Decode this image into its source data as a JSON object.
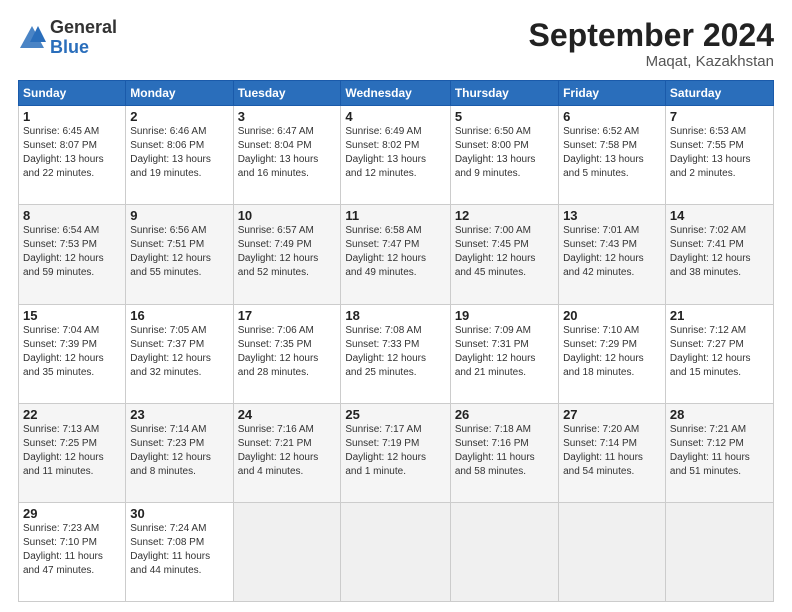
{
  "logo": {
    "general": "General",
    "blue": "Blue"
  },
  "title": "September 2024",
  "subtitle": "Maqat, Kazakhstan",
  "days_header": [
    "Sunday",
    "Monday",
    "Tuesday",
    "Wednesday",
    "Thursday",
    "Friday",
    "Saturday"
  ],
  "weeks": [
    [
      {
        "day": "1",
        "info": "Sunrise: 6:45 AM\nSunset: 8:07 PM\nDaylight: 13 hours\nand 22 minutes."
      },
      {
        "day": "2",
        "info": "Sunrise: 6:46 AM\nSunset: 8:06 PM\nDaylight: 13 hours\nand 19 minutes."
      },
      {
        "day": "3",
        "info": "Sunrise: 6:47 AM\nSunset: 8:04 PM\nDaylight: 13 hours\nand 16 minutes."
      },
      {
        "day": "4",
        "info": "Sunrise: 6:49 AM\nSunset: 8:02 PM\nDaylight: 13 hours\nand 12 minutes."
      },
      {
        "day": "5",
        "info": "Sunrise: 6:50 AM\nSunset: 8:00 PM\nDaylight: 13 hours\nand 9 minutes."
      },
      {
        "day": "6",
        "info": "Sunrise: 6:52 AM\nSunset: 7:58 PM\nDaylight: 13 hours\nand 5 minutes."
      },
      {
        "day": "7",
        "info": "Sunrise: 6:53 AM\nSunset: 7:55 PM\nDaylight: 13 hours\nand 2 minutes."
      }
    ],
    [
      {
        "day": "8",
        "info": "Sunrise: 6:54 AM\nSunset: 7:53 PM\nDaylight: 12 hours\nand 59 minutes."
      },
      {
        "day": "9",
        "info": "Sunrise: 6:56 AM\nSunset: 7:51 PM\nDaylight: 12 hours\nand 55 minutes."
      },
      {
        "day": "10",
        "info": "Sunrise: 6:57 AM\nSunset: 7:49 PM\nDaylight: 12 hours\nand 52 minutes."
      },
      {
        "day": "11",
        "info": "Sunrise: 6:58 AM\nSunset: 7:47 PM\nDaylight: 12 hours\nand 49 minutes."
      },
      {
        "day": "12",
        "info": "Sunrise: 7:00 AM\nSunset: 7:45 PM\nDaylight: 12 hours\nand 45 minutes."
      },
      {
        "day": "13",
        "info": "Sunrise: 7:01 AM\nSunset: 7:43 PM\nDaylight: 12 hours\nand 42 minutes."
      },
      {
        "day": "14",
        "info": "Sunrise: 7:02 AM\nSunset: 7:41 PM\nDaylight: 12 hours\nand 38 minutes."
      }
    ],
    [
      {
        "day": "15",
        "info": "Sunrise: 7:04 AM\nSunset: 7:39 PM\nDaylight: 12 hours\nand 35 minutes."
      },
      {
        "day": "16",
        "info": "Sunrise: 7:05 AM\nSunset: 7:37 PM\nDaylight: 12 hours\nand 32 minutes."
      },
      {
        "day": "17",
        "info": "Sunrise: 7:06 AM\nSunset: 7:35 PM\nDaylight: 12 hours\nand 28 minutes."
      },
      {
        "day": "18",
        "info": "Sunrise: 7:08 AM\nSunset: 7:33 PM\nDaylight: 12 hours\nand 25 minutes."
      },
      {
        "day": "19",
        "info": "Sunrise: 7:09 AM\nSunset: 7:31 PM\nDaylight: 12 hours\nand 21 minutes."
      },
      {
        "day": "20",
        "info": "Sunrise: 7:10 AM\nSunset: 7:29 PM\nDaylight: 12 hours\nand 18 minutes."
      },
      {
        "day": "21",
        "info": "Sunrise: 7:12 AM\nSunset: 7:27 PM\nDaylight: 12 hours\nand 15 minutes."
      }
    ],
    [
      {
        "day": "22",
        "info": "Sunrise: 7:13 AM\nSunset: 7:25 PM\nDaylight: 12 hours\nand 11 minutes."
      },
      {
        "day": "23",
        "info": "Sunrise: 7:14 AM\nSunset: 7:23 PM\nDaylight: 12 hours\nand 8 minutes."
      },
      {
        "day": "24",
        "info": "Sunrise: 7:16 AM\nSunset: 7:21 PM\nDaylight: 12 hours\nand 4 minutes."
      },
      {
        "day": "25",
        "info": "Sunrise: 7:17 AM\nSunset: 7:19 PM\nDaylight: 12 hours\nand 1 minute."
      },
      {
        "day": "26",
        "info": "Sunrise: 7:18 AM\nSunset: 7:16 PM\nDaylight: 11 hours\nand 58 minutes."
      },
      {
        "day": "27",
        "info": "Sunrise: 7:20 AM\nSunset: 7:14 PM\nDaylight: 11 hours\nand 54 minutes."
      },
      {
        "day": "28",
        "info": "Sunrise: 7:21 AM\nSunset: 7:12 PM\nDaylight: 11 hours\nand 51 minutes."
      }
    ],
    [
      {
        "day": "29",
        "info": "Sunrise: 7:23 AM\nSunset: 7:10 PM\nDaylight: 11 hours\nand 47 minutes."
      },
      {
        "day": "30",
        "info": "Sunrise: 7:24 AM\nSunset: 7:08 PM\nDaylight: 11 hours\nand 44 minutes."
      },
      null,
      null,
      null,
      null,
      null
    ]
  ]
}
